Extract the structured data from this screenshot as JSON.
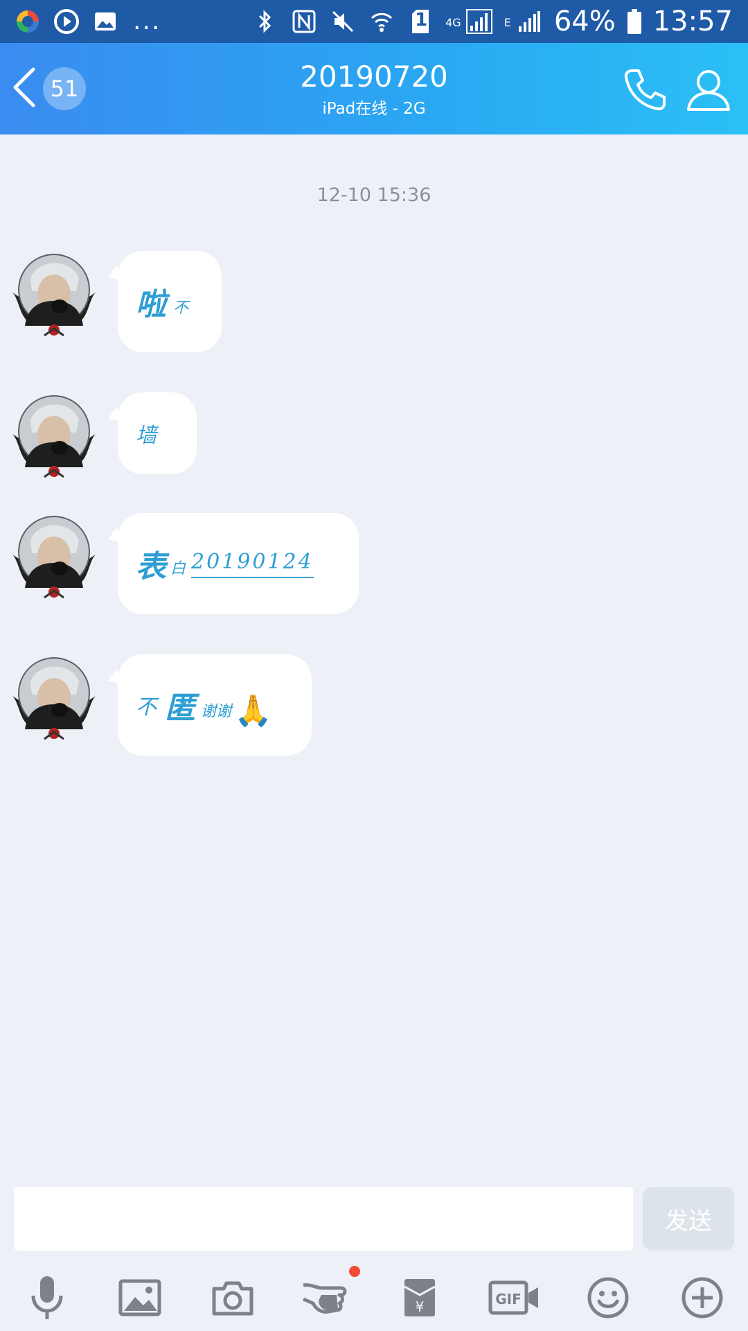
{
  "status_bar": {
    "battery": "64%",
    "time": "13:57",
    "network_type": "4G",
    "sim_slot": "1",
    "secondary_network": "E",
    "overflow": "..."
  },
  "header": {
    "unread_count": "51",
    "title": "20190720",
    "subtitle": "iPad在线 - 2G"
  },
  "chat": {
    "timestamp": "12-10 15:36",
    "messages": [
      {
        "parts": [
          "啦",
          "不"
        ]
      },
      {
        "parts": [
          "墙"
        ]
      },
      {
        "parts": [
          "表",
          "白",
          "20190124"
        ]
      },
      {
        "parts": [
          "不",
          "匿",
          "谢谢",
          "🙏"
        ]
      }
    ]
  },
  "composer": {
    "input_placeholder": "",
    "send_label": "发送"
  },
  "toolbar": {
    "icons": [
      "microphone-icon",
      "image-icon",
      "camera-icon",
      "poke-icon",
      "red-packet-icon",
      "gif-icon",
      "emoji-icon",
      "plus-icon"
    ],
    "poke_has_notification": true
  },
  "colors": {
    "header_start": "#3a8cf0",
    "header_end": "#2bc0f6",
    "background": "#edf1f7",
    "art_text": "#2e9fd4",
    "notification_dot": "#f24a35"
  }
}
